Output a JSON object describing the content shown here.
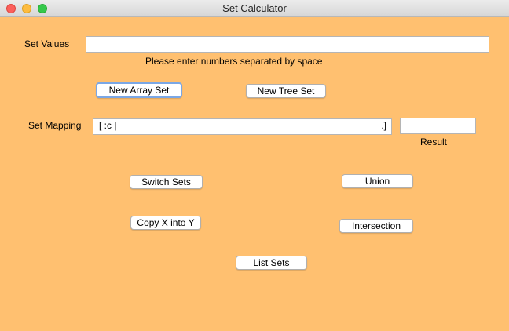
{
  "window": {
    "title": "Set Calculator"
  },
  "set_values": {
    "label": "Set Values",
    "value": "",
    "hint": "Please enter numbers separated by space"
  },
  "buttons": {
    "new_array_set": "New Array Set",
    "new_tree_set": "New Tree Set",
    "switch_sets": "Switch Sets",
    "union": "Union",
    "copy_x_into_y": "Copy X into Y",
    "intersection": "Intersection",
    "list_sets": "List Sets"
  },
  "set_mapping": {
    "label": "Set Mapping",
    "value_left": "[ :c |",
    "value_right": ".]"
  },
  "result": {
    "label": "Result",
    "value": ""
  },
  "colors": {
    "background": "#ffc070",
    "focus_ring": "#7aa7e6"
  }
}
